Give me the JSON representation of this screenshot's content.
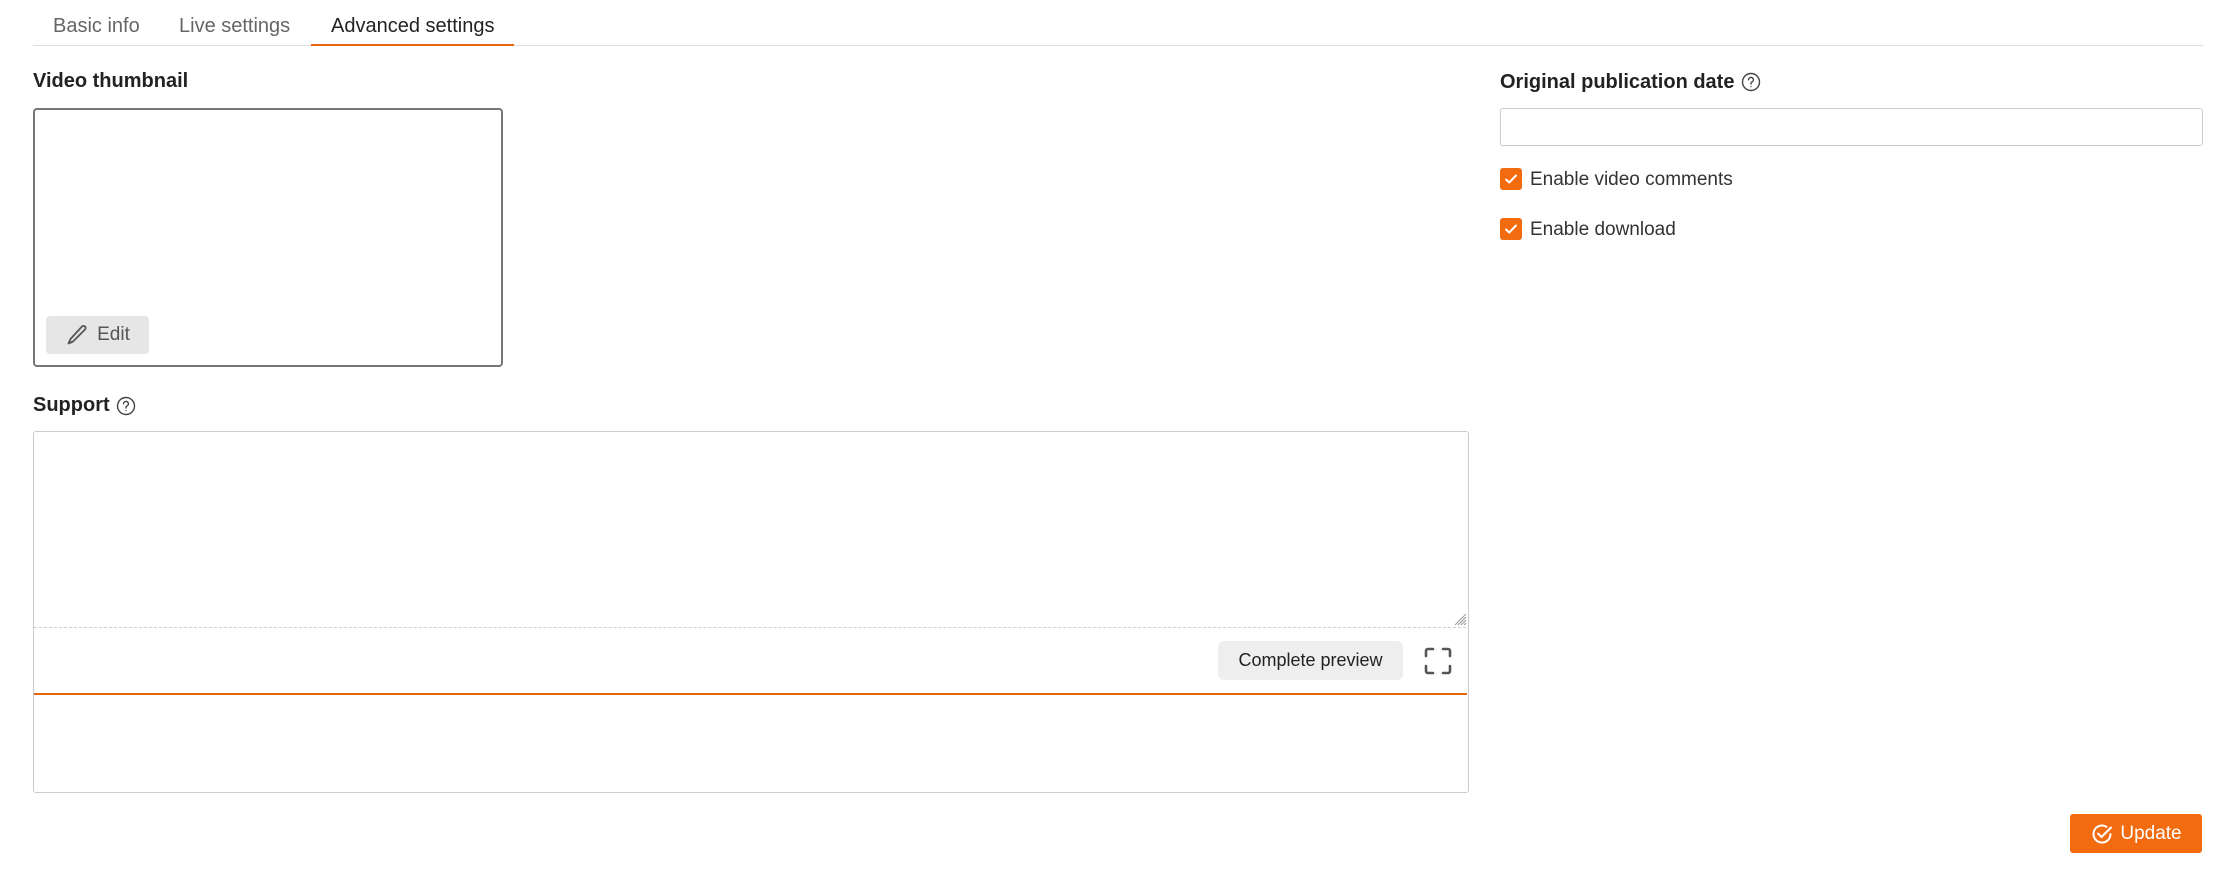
{
  "tabs": [
    {
      "label": "Basic info",
      "active": false
    },
    {
      "label": "Live settings",
      "active": false
    },
    {
      "label": "Advanced settings",
      "active": true
    }
  ],
  "thumbnail": {
    "label": "Video thumbnail",
    "edit_label": "Edit",
    "edit_icon": "pencil-icon"
  },
  "support": {
    "label": "Support",
    "help_icon": "help-circle-icon",
    "value": "",
    "preview_label": "Complete preview",
    "fullscreen_icon": "fullscreen-icon"
  },
  "publication_date": {
    "label": "Original publication date",
    "help_icon": "help-circle-icon",
    "value": "",
    "placeholder": ""
  },
  "options": [
    {
      "label": "Enable video comments",
      "checked": true
    },
    {
      "label": "Enable download",
      "checked": true
    }
  ],
  "actions": {
    "update_label": "Update",
    "update_icon": "check-circle-icon"
  },
  "colors": {
    "accent": "#f26b0f",
    "tab_underline": "#e8650f",
    "text": "#222222",
    "muted_text": "#666666"
  }
}
